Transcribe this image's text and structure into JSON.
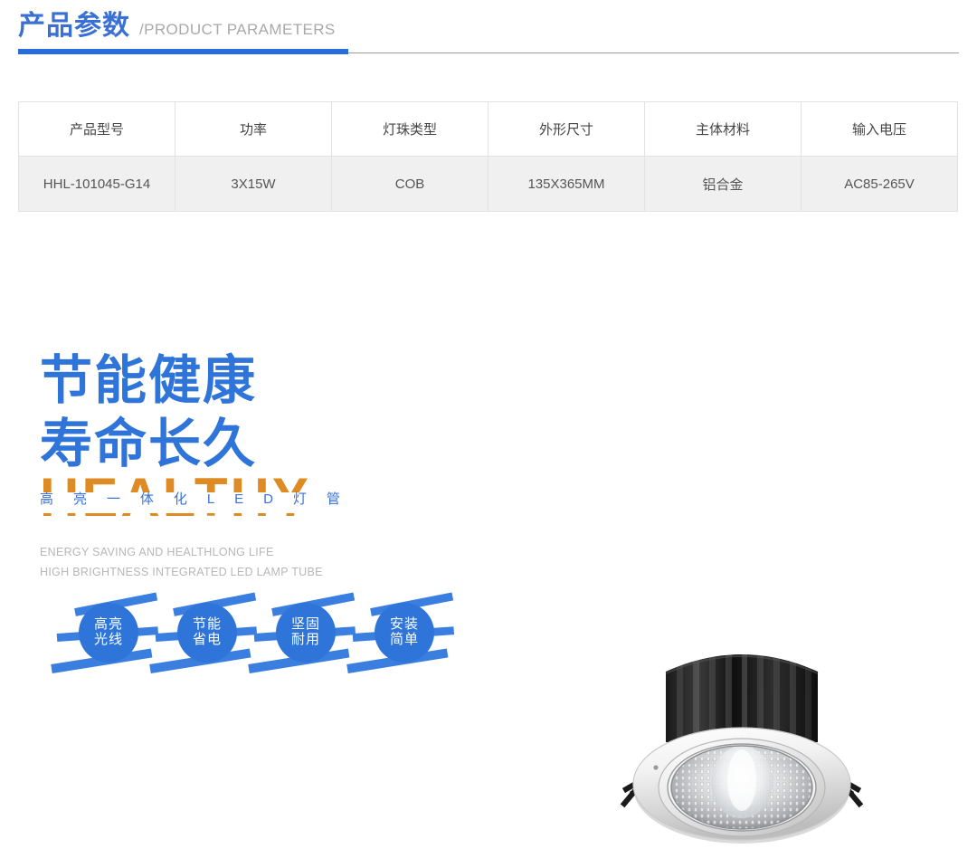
{
  "header": {
    "title_cn": "产品参数",
    "title_en": "/PRODUCT PARAMETERS",
    "accent_color": "#2a6cd8",
    "en_color": "#a9a9a9"
  },
  "spec_table": {
    "columns": [
      "产品型号",
      "功率",
      "灯珠类型",
      "外形尺寸",
      "主体材料",
      "输入电压"
    ],
    "rows": [
      [
        "HHL-101045-G14",
        "3X15W",
        "COB",
        "135X365MM",
        "铝合金",
        "AC85-265V"
      ]
    ],
    "header_bg": "#ffffff",
    "row_bg": "#f0f0f0",
    "border_color": "#e2e2e2"
  },
  "promo": {
    "headline_line1": "节能健康",
    "headline_line2": "寿命长久",
    "headline_color": "#2f74d8",
    "watermark_word": "HEALTHY",
    "watermark_color": "#dd8b22",
    "sub_cn_chars": [
      "高",
      "亮",
      "一",
      "体",
      "化",
      "L",
      "E",
      "D",
      "灯",
      "管"
    ],
    "sub_cn_color": "#3a72d6",
    "english_line1": "ENERGY SAVING AND HEALTHLONG LIFE",
    "english_line2": "HIGH BRIGHTNESS INTEGRATED LED LAMP TUBE",
    "english_color": "#b7b7b7"
  },
  "badges": {
    "color": "#2f74d8",
    "items": [
      {
        "line1": "高亮",
        "line2": "光线"
      },
      {
        "line1": "节能",
        "line2": "省电"
      },
      {
        "line1": "坚固",
        "line2": "耐用"
      },
      {
        "line1": "安装",
        "line2": "简单"
      }
    ]
  },
  "product_image": {
    "name": "led-recessed-downlight",
    "alt": "LED COB recessed downlight with black finned heatsink and white trim ring"
  }
}
